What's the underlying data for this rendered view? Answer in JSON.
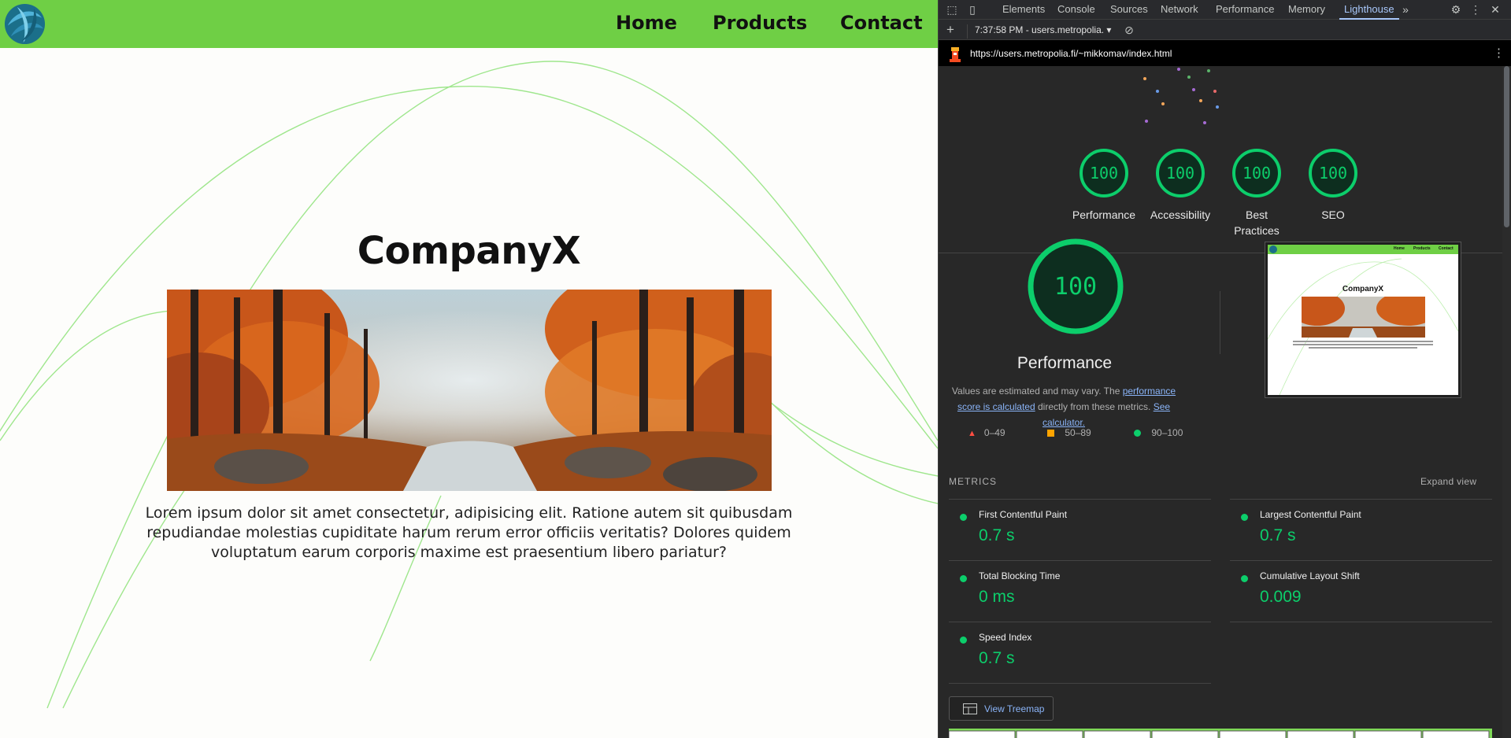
{
  "site": {
    "nav": {
      "home": "Home",
      "products": "Products",
      "contact": "Contact"
    },
    "title": "CompanyX",
    "paragraph": "Lorem ipsum dolor sit amet consectetur, adipisicing elit. Ratione autem sit quibusdam repudiandae molestias cupiditate harum rerum error officiis veritatis? Dolores quidem voluptatum earum corporis maxime est praesentium libero pariatur?",
    "colors": {
      "nav_bg": "#6fcf45",
      "curve": "#8fe37a"
    }
  },
  "devtools": {
    "tabs": [
      "Elements",
      "Console",
      "Sources",
      "Network",
      "Performance",
      "Memory",
      "Lighthouse"
    ],
    "active_tab": "Lighthouse",
    "report_select": "7:37:58 PM - users.metropolia.",
    "url": "https://users.metropolia.fi/~mikkomav/index.html",
    "categories": [
      {
        "label": "Performance",
        "score": 100
      },
      {
        "label": "Accessibility",
        "score": 100
      },
      {
        "label": "Best Practices",
        "score": 100
      },
      {
        "label": "SEO",
        "score": 100
      }
    ],
    "main": {
      "score": 100,
      "title": "Performance",
      "desc_before": "Values are estimated and may vary. The ",
      "desc_link1": "performance score is calculated",
      "desc_middle": " directly from these metrics. ",
      "desc_link2": "See calculator."
    },
    "legend": [
      "0–49",
      "50–89",
      "90–100"
    ],
    "metrics_heading": "METRICS",
    "expand_view": "Expand view",
    "metrics": [
      {
        "name": "First Contentful Paint",
        "value": "0.7 s"
      },
      {
        "name": "Largest Contentful Paint",
        "value": "0.7 s"
      },
      {
        "name": "Total Blocking Time",
        "value": "0 ms"
      },
      {
        "name": "Cumulative Layout Shift",
        "value": "0.009"
      },
      {
        "name": "Speed Index",
        "value": "0.7 s"
      }
    ],
    "view_treemap": "View Treemap",
    "thumbnail": {
      "nav": [
        "Home",
        "Products",
        "Contact"
      ],
      "title": "CompanyX"
    },
    "colors": {
      "pass": "#0cce6b",
      "average": "#ffa400",
      "fail": "#ff4e42",
      "link": "#8ab4f8"
    }
  }
}
